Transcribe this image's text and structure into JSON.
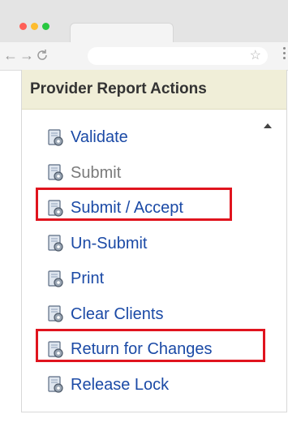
{
  "window": {
    "traffic_lights": [
      "#ff5f57",
      "#febc2e",
      "#28c840"
    ]
  },
  "toolbar": {
    "back_icon": "back-arrow-icon",
    "forward_icon": "forward-arrow-icon",
    "reload_icon": "reload-icon",
    "address_value": "",
    "bookmark_icon": "star-icon",
    "menu_icon": "vertical-dots-icon"
  },
  "panel": {
    "title": "Provider Report Actions",
    "actions": [
      {
        "label": "Validate",
        "icon": "gear-document-icon",
        "enabled": true,
        "highlighted": false
      },
      {
        "label": "Submit",
        "icon": "gear-document-icon",
        "enabled": false,
        "highlighted": false
      },
      {
        "label": "Submit / Accept",
        "icon": "gear-document-icon",
        "enabled": true,
        "highlighted": true
      },
      {
        "label": "Un-Submit",
        "icon": "gear-document-icon",
        "enabled": true,
        "highlighted": false
      },
      {
        "label": "Print",
        "icon": "gear-document-icon",
        "enabled": true,
        "highlighted": false
      },
      {
        "label": "Clear Clients",
        "icon": "gear-document-icon",
        "enabled": true,
        "highlighted": false
      },
      {
        "label": "Return for Changes",
        "icon": "gear-document-icon",
        "enabled": true,
        "highlighted": true
      },
      {
        "label": "Release Lock",
        "icon": "gear-document-icon",
        "enabled": true,
        "highlighted": false
      }
    ]
  },
  "colors": {
    "link": "#1b4aa6",
    "disabled": "#7a7a7a",
    "header_bg": "#f0eed8",
    "highlight": "#e0141e"
  }
}
